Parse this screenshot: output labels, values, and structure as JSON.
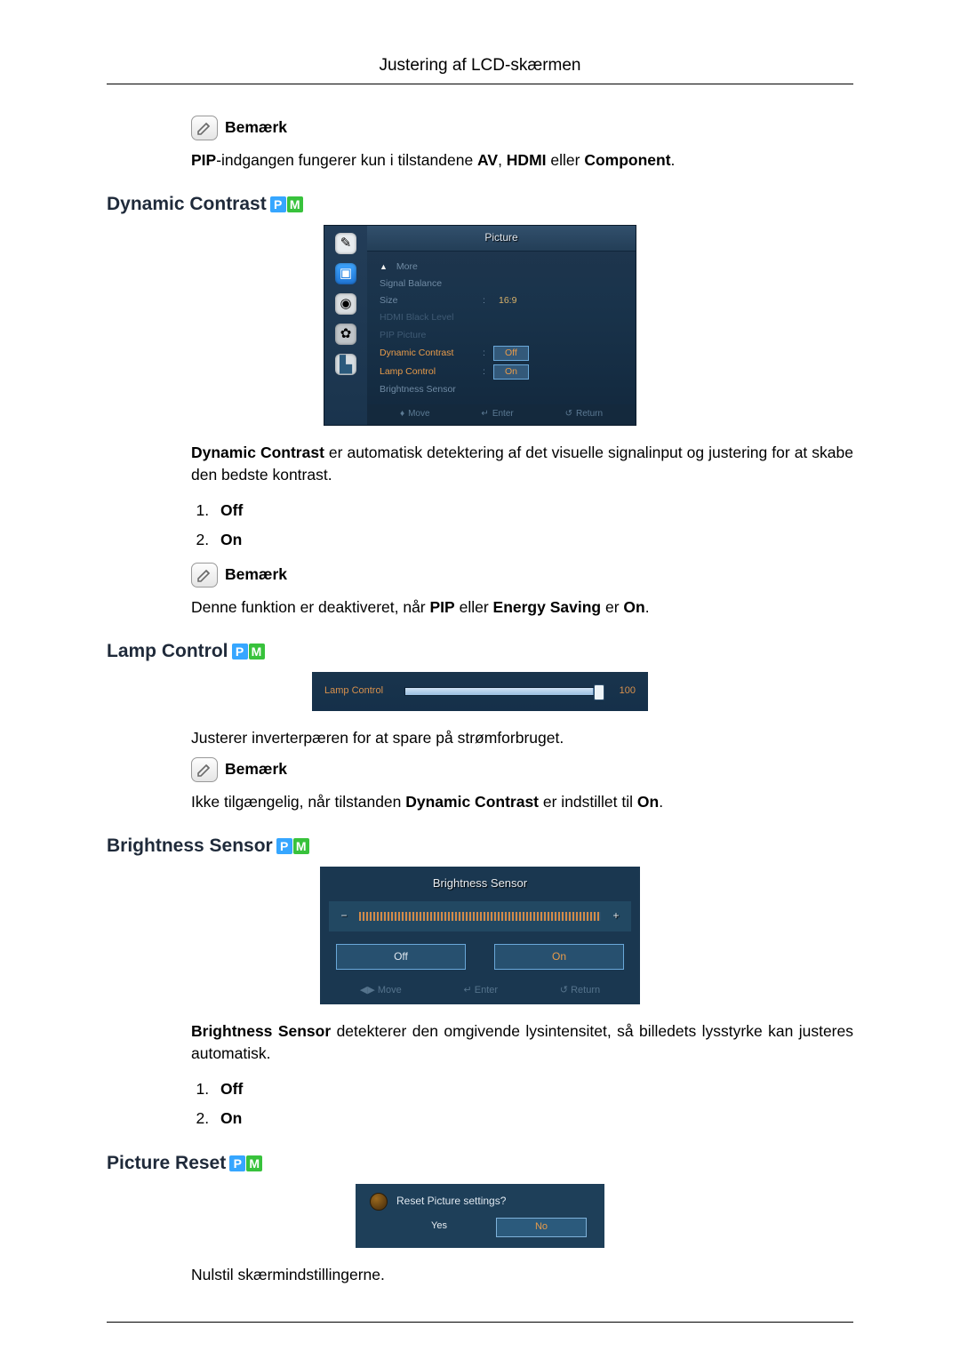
{
  "page": {
    "header": "Justering af LCD-skærmen"
  },
  "notes": {
    "label": "Bemærk",
    "pip_inputs": "PIP-indgangen fungerer kun i tilstandene AV, HDMI eller Component.",
    "dc_disabled": "Denne funktion er deaktiveret, når PIP eller Energy Saving er On.",
    "lc_na": "Ikke tilgængelig, når tilstanden Dynamic Contrast er indstillet til On."
  },
  "sections": {
    "dc": {
      "title": "Dynamic Contrast",
      "desc": "Dynamic Contrast er automatisk detektering af det visuelle signalinput og justering for at skabe den bedste kontrast.",
      "opts": {
        "off": "Off",
        "on": "On"
      }
    },
    "lc": {
      "title": "Lamp Control",
      "desc": "Justerer inverterpæren for at spare på strømforbruget."
    },
    "bs": {
      "title": "Brightness Sensor",
      "desc": "Brightness Sensor detekterer den omgivende lysintensitet, så billedets lysstyrke kan justeres automatisk.",
      "opts": {
        "off": "Off",
        "on": "On"
      }
    },
    "pr": {
      "title": "Picture Reset",
      "desc": "Nulstil skærmindstillingerne."
    }
  },
  "osd_picture": {
    "title": "Picture",
    "rows": {
      "more": "More",
      "signal_balance": "Signal Balance",
      "size": "Size",
      "size_val": "16:9",
      "hdmi_black": "HDMI Black Level",
      "pip_picture": "PIP Picture",
      "dynamic_contrast": "Dynamic Contrast",
      "dc_val": "Off",
      "lamp_control": "Lamp Control",
      "lc_val": "On",
      "brightness_sensor": "Brightness Sensor"
    },
    "footer": {
      "move": "Move",
      "enter": "Enter",
      "return": "Return"
    }
  },
  "osd_lamp": {
    "label": "Lamp Control",
    "value": "100"
  },
  "osd_bs": {
    "title": "Brightness Sensor",
    "off": "Off",
    "on": "On",
    "footer": {
      "move": "Move",
      "enter": "Enter",
      "return": "Return"
    }
  },
  "osd_reset": {
    "prompt": "Reset Picture settings?",
    "yes": "Yes",
    "no": "No"
  }
}
